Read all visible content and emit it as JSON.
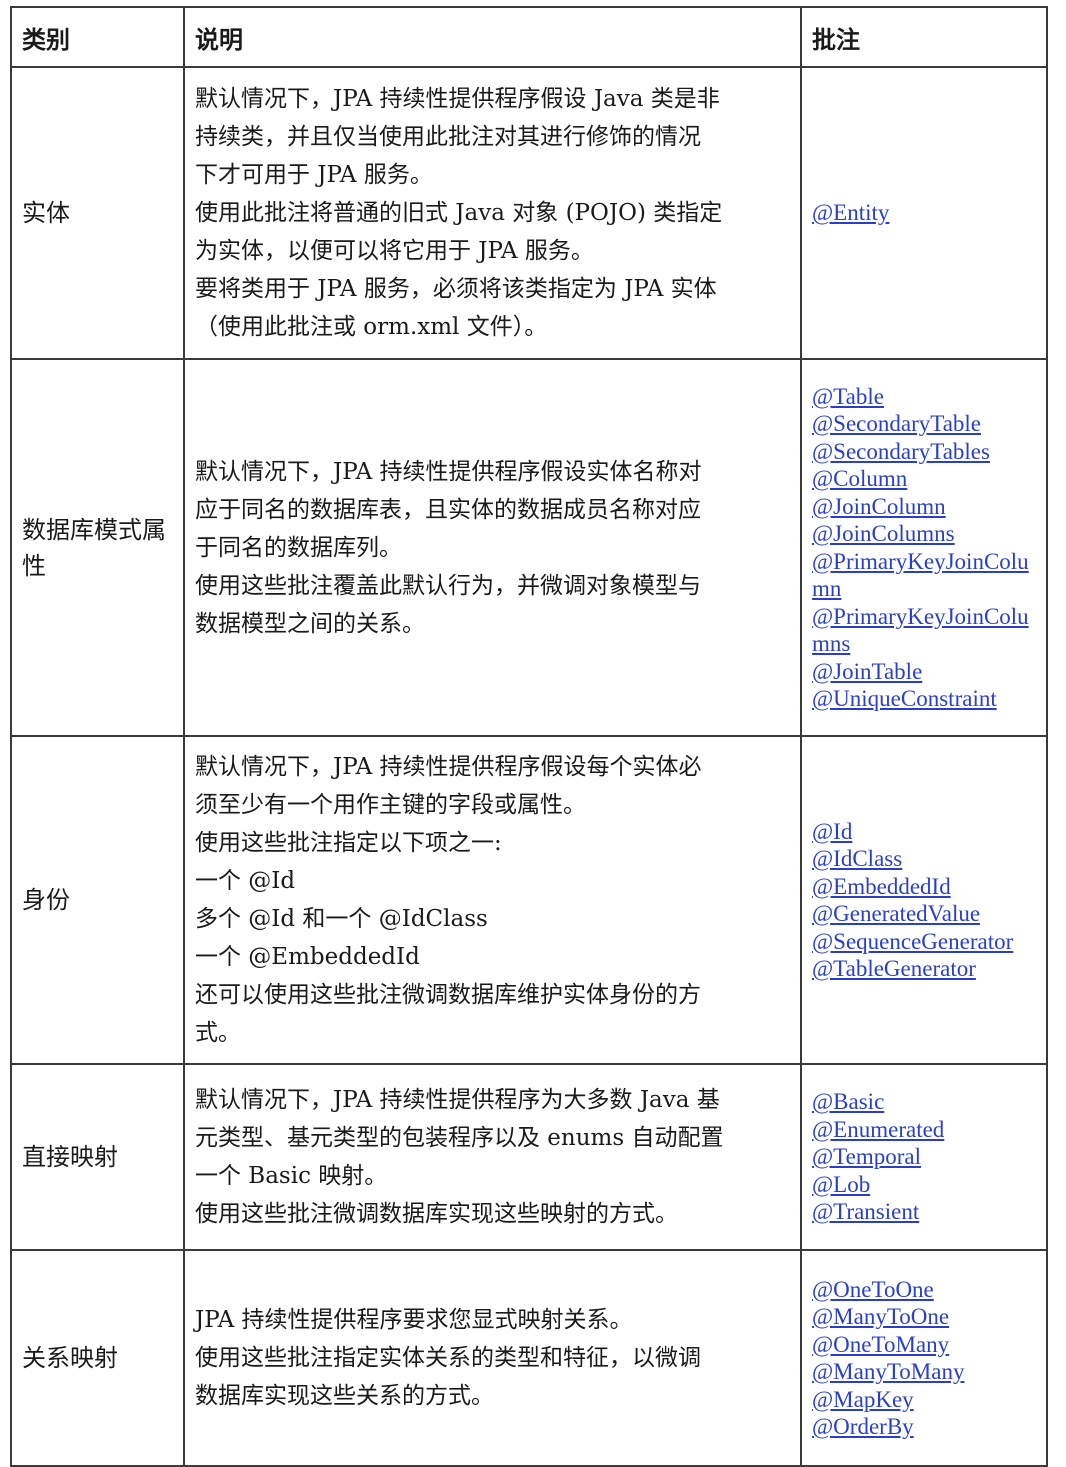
{
  "header": {
    "category": "类别",
    "description": "说明",
    "annotations": "批注"
  },
  "rows": [
    {
      "category": "实体",
      "description_lines": [
        "默认情况下，JPA 持续性提供程序假设 Java 类是非",
        "持续类，并且仅当使用此批注对其进行修饰的情况",
        "下才可用于 JPA 服务。",
        "使用此批注将普通的旧式 Java 对象 (POJO) 类指定",
        "为实体，以便可以将它用于 JPA 服务。",
        "要将类用于 JPA 服务，必须将该类指定为 JPA 实体",
        "（使用此批注或 orm.xml 文件）。"
      ],
      "annotations": [
        "@Entity"
      ]
    },
    {
      "category": "数据库模式属性",
      "description_lines": [
        "默认情况下，JPA 持续性提供程序假设实体名称对",
        "应于同名的数据库表，且实体的数据成员名称对应",
        "于同名的数据库列。",
        "使用这些批注覆盖此默认行为，并微调对象模型与",
        "数据模型之间的关系。"
      ],
      "annotations": [
        "@Table",
        "@SecondaryTable",
        "@SecondaryTables",
        "@Column",
        "@JoinColumn",
        "@JoinColumns",
        "@PrimaryKeyJoinColumn",
        "@PrimaryKeyJoinColumns",
        "@JoinTable",
        "@UniqueConstraint"
      ]
    },
    {
      "category": "身份",
      "description_lines": [
        "默认情况下，JPA 持续性提供程序假设每个实体必",
        "须至少有一个用作主键的字段或属性。",
        "使用这些批注指定以下项之一:",
        "一个 @Id",
        "多个 @Id 和一个 @IdClass",
        "一个 @EmbeddedId",
        "还可以使用这些批注微调数据库维护实体身份的方",
        "式。"
      ],
      "annotations": [
        "@Id",
        "@IdClass",
        "@EmbeddedId",
        "@GeneratedValue",
        "@SequenceGenerator",
        "@TableGenerator"
      ]
    },
    {
      "category": "直接映射",
      "description_lines": [
        "默认情况下，JPA 持续性提供程序为大多数 Java 基",
        "元类型、基元类型的包装程序以及 enums 自动配置",
        "一个 Basic 映射。",
        "使用这些批注微调数据库实现这些映射的方式。"
      ],
      "annotations": [
        "@Basic",
        "@Enumerated",
        "@Temporal",
        "@Lob",
        "@Transient"
      ]
    },
    {
      "category": "关系映射",
      "description_lines": [
        "JPA 持续性提供程序要求您显式映射关系。",
        "使用这些批注指定实体关系的类型和特征，以微调",
        "数据库实现这些关系的方式。"
      ],
      "annotations": [
        "@OneToOne",
        "@ManyToOne",
        "@OneToMany",
        "@ManyToMany",
        "@MapKey",
        "@OrderBy"
      ]
    }
  ],
  "colors": {
    "link": "#2a3fc9",
    "border": "#3a3a3a",
    "text": "#1a1a1a"
  }
}
